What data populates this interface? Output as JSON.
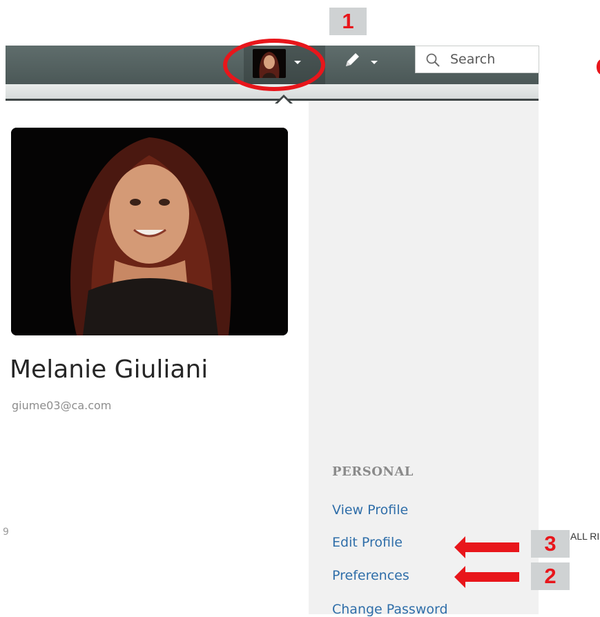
{
  "header": {
    "search": {
      "placeholder": "Search"
    },
    "annotation_numbers": [
      "1",
      "2",
      "3"
    ]
  },
  "profile": {
    "name": "Melanie Giuliani",
    "email": "giume03@ca.com"
  },
  "menu": {
    "section_title": "PERSONAL",
    "items": [
      "View Profile",
      "Edit Profile",
      "Preferences",
      "Change Password"
    ]
  },
  "footer": {
    "left_fragment": "9",
    "right_fragment": "ALL RI"
  },
  "colors": {
    "nav_bar": "#55615f",
    "link": "#2f6ea9",
    "annotation_red": "#e8161b",
    "badge_bg": "#cfd2d3"
  },
  "icons": [
    "avatar-thumbnail",
    "caret-down-icon",
    "pencil-icon",
    "search-icon",
    "arrow-left-icon"
  ]
}
